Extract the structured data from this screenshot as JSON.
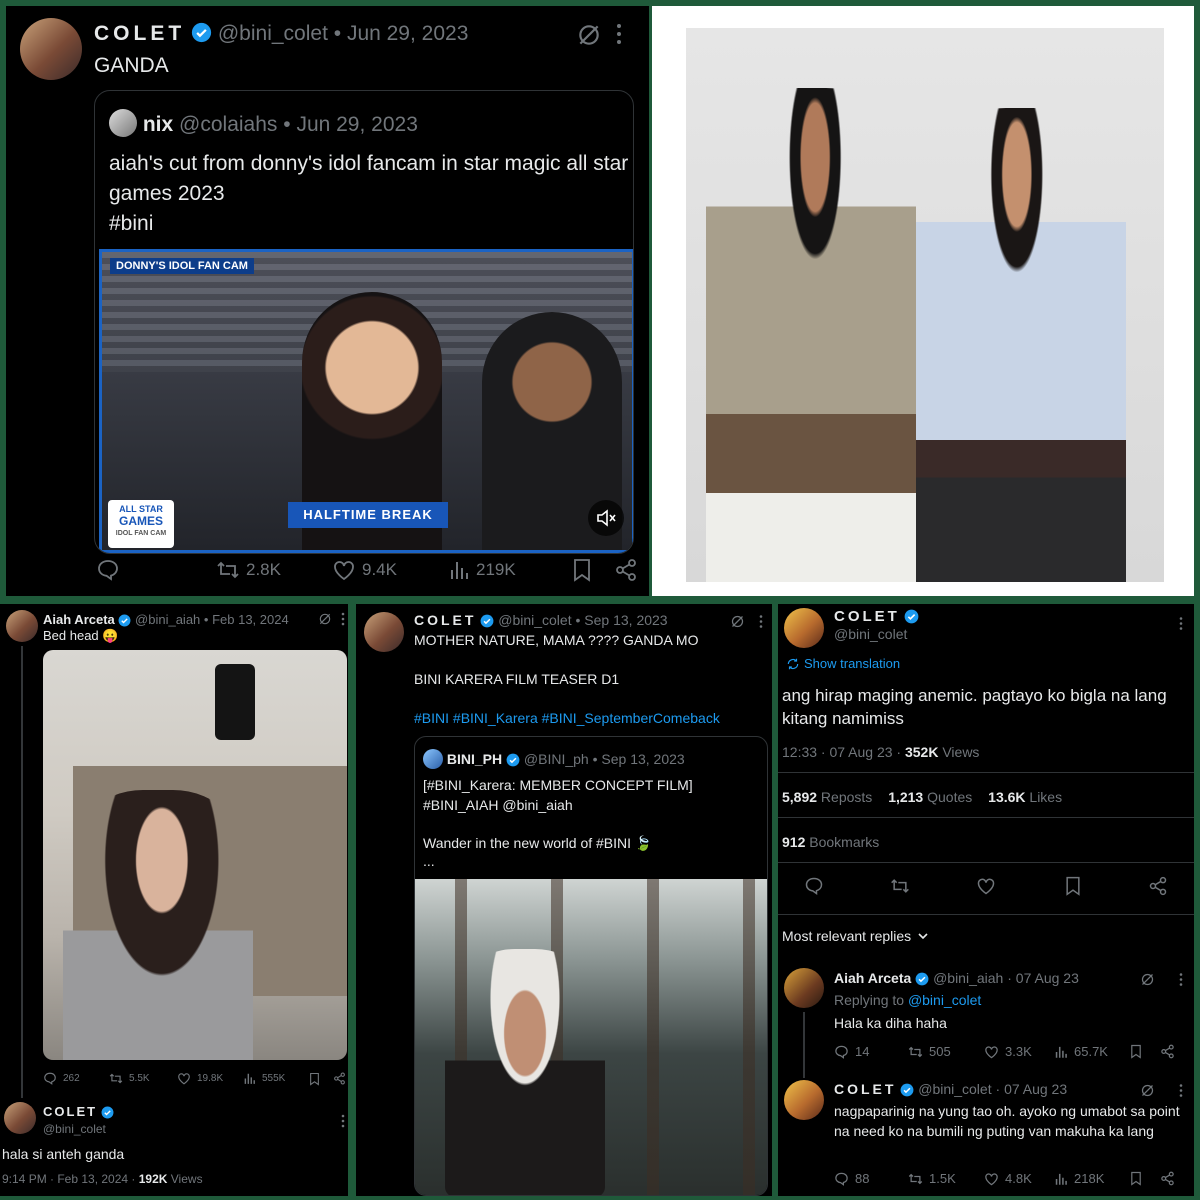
{
  "p1": {
    "author": "COLET",
    "handle": "@bini_colet",
    "date": "Jun 29, 2023",
    "text": "GANDA",
    "quote": {
      "author": "nix",
      "handle": "@colaiahs",
      "date": "Jun 29, 2023",
      "text1": "aiah's cut from donny's idol fancam in star magic all star games 2023",
      "text2": "#bini"
    },
    "video": {
      "banner": "DONNY'S IDOL FAN CAM",
      "lower_third": "HALFTIME BREAK",
      "badge1": "ALL STAR",
      "badge2": "GAMES",
      "badge3": "IDOL FAN CAM"
    },
    "stats": {
      "reposts": "2.8K",
      "likes": "9.4K",
      "views": "219K"
    }
  },
  "p3": {
    "author": "Aiah Arceta",
    "handle": "@bini_aiah",
    "date": "Feb 13, 2024",
    "text": "Bed head 😛",
    "stats": {
      "replies": "262",
      "reposts": "5.5K",
      "likes": "19.8K",
      "views": "555K"
    },
    "reply": {
      "author": "COLET",
      "handle": "@bini_colet",
      "text": "hala si anteh ganda",
      "time": "9:14 PM · Feb 13, 2024 · ",
      "views_count": "192K",
      "views_label": " Views"
    }
  },
  "p4": {
    "author": "COLET",
    "handle": "@bini_colet",
    "date": "Sep 13, 2023",
    "line1": "MOTHER NATURE, MAMA ???? GANDA MO",
    "line2": "BINI KARERA FILM TEASER D1",
    "hashtags": "#BINI #BINI_Karera #BINI_SeptemberComeback",
    "quote": {
      "author": "BINI_PH",
      "handle": "@BINI_ph",
      "date": "Sep 13, 2023",
      "line1": "[#BINI_Karera: MEMBER CONCEPT FILM]",
      "line2": "#BINI_AIAH @bini_aiah",
      "line3": "Wander in the new world of #BINI 🍃",
      "line4": "..."
    }
  },
  "p5": {
    "author": "COLET",
    "handle": "@bini_colet",
    "show_translation": "Show translation",
    "text": "ang hirap maging anemic. pagtayo ko bigla na lang kitang namimiss",
    "time": "12:33 · 07 Aug 23 · ",
    "views_count": "352K",
    "views_label": " Views",
    "reposts_count": "5,892",
    "reposts_label": " Reposts",
    "quotes_count": "1,213",
    "quotes_label": " Quotes",
    "likes_count": "13.6K",
    "likes_label": " Likes",
    "bookmarks_count": "912",
    "bookmarks_label": " Bookmarks",
    "replies_sort": "Most relevant replies",
    "reply1": {
      "author": "Aiah Arceta",
      "handle": "@bini_aiah",
      "date": "07 Aug 23",
      "replying_label": "Replying to ",
      "replying_handle": "@bini_colet",
      "text": "Hala ka diha haha",
      "stats": {
        "replies": "14",
        "reposts": "505",
        "likes": "3.3K",
        "views": "65.7K"
      }
    },
    "reply2": {
      "author": "COLET",
      "handle": "@bini_colet",
      "date": "07 Aug 23",
      "text": "nagpaparinig na yung tao oh. ayoko ng umabot sa point na need ko na bumili ng puting van makuha ka lang",
      "stats": {
        "replies": "88",
        "reposts": "1.5K",
        "likes": "4.8K",
        "views": "218K"
      }
    }
  },
  "colors": {
    "frame": "#1f5a3a",
    "accent": "#1d9bf0",
    "muted": "#71767b"
  }
}
